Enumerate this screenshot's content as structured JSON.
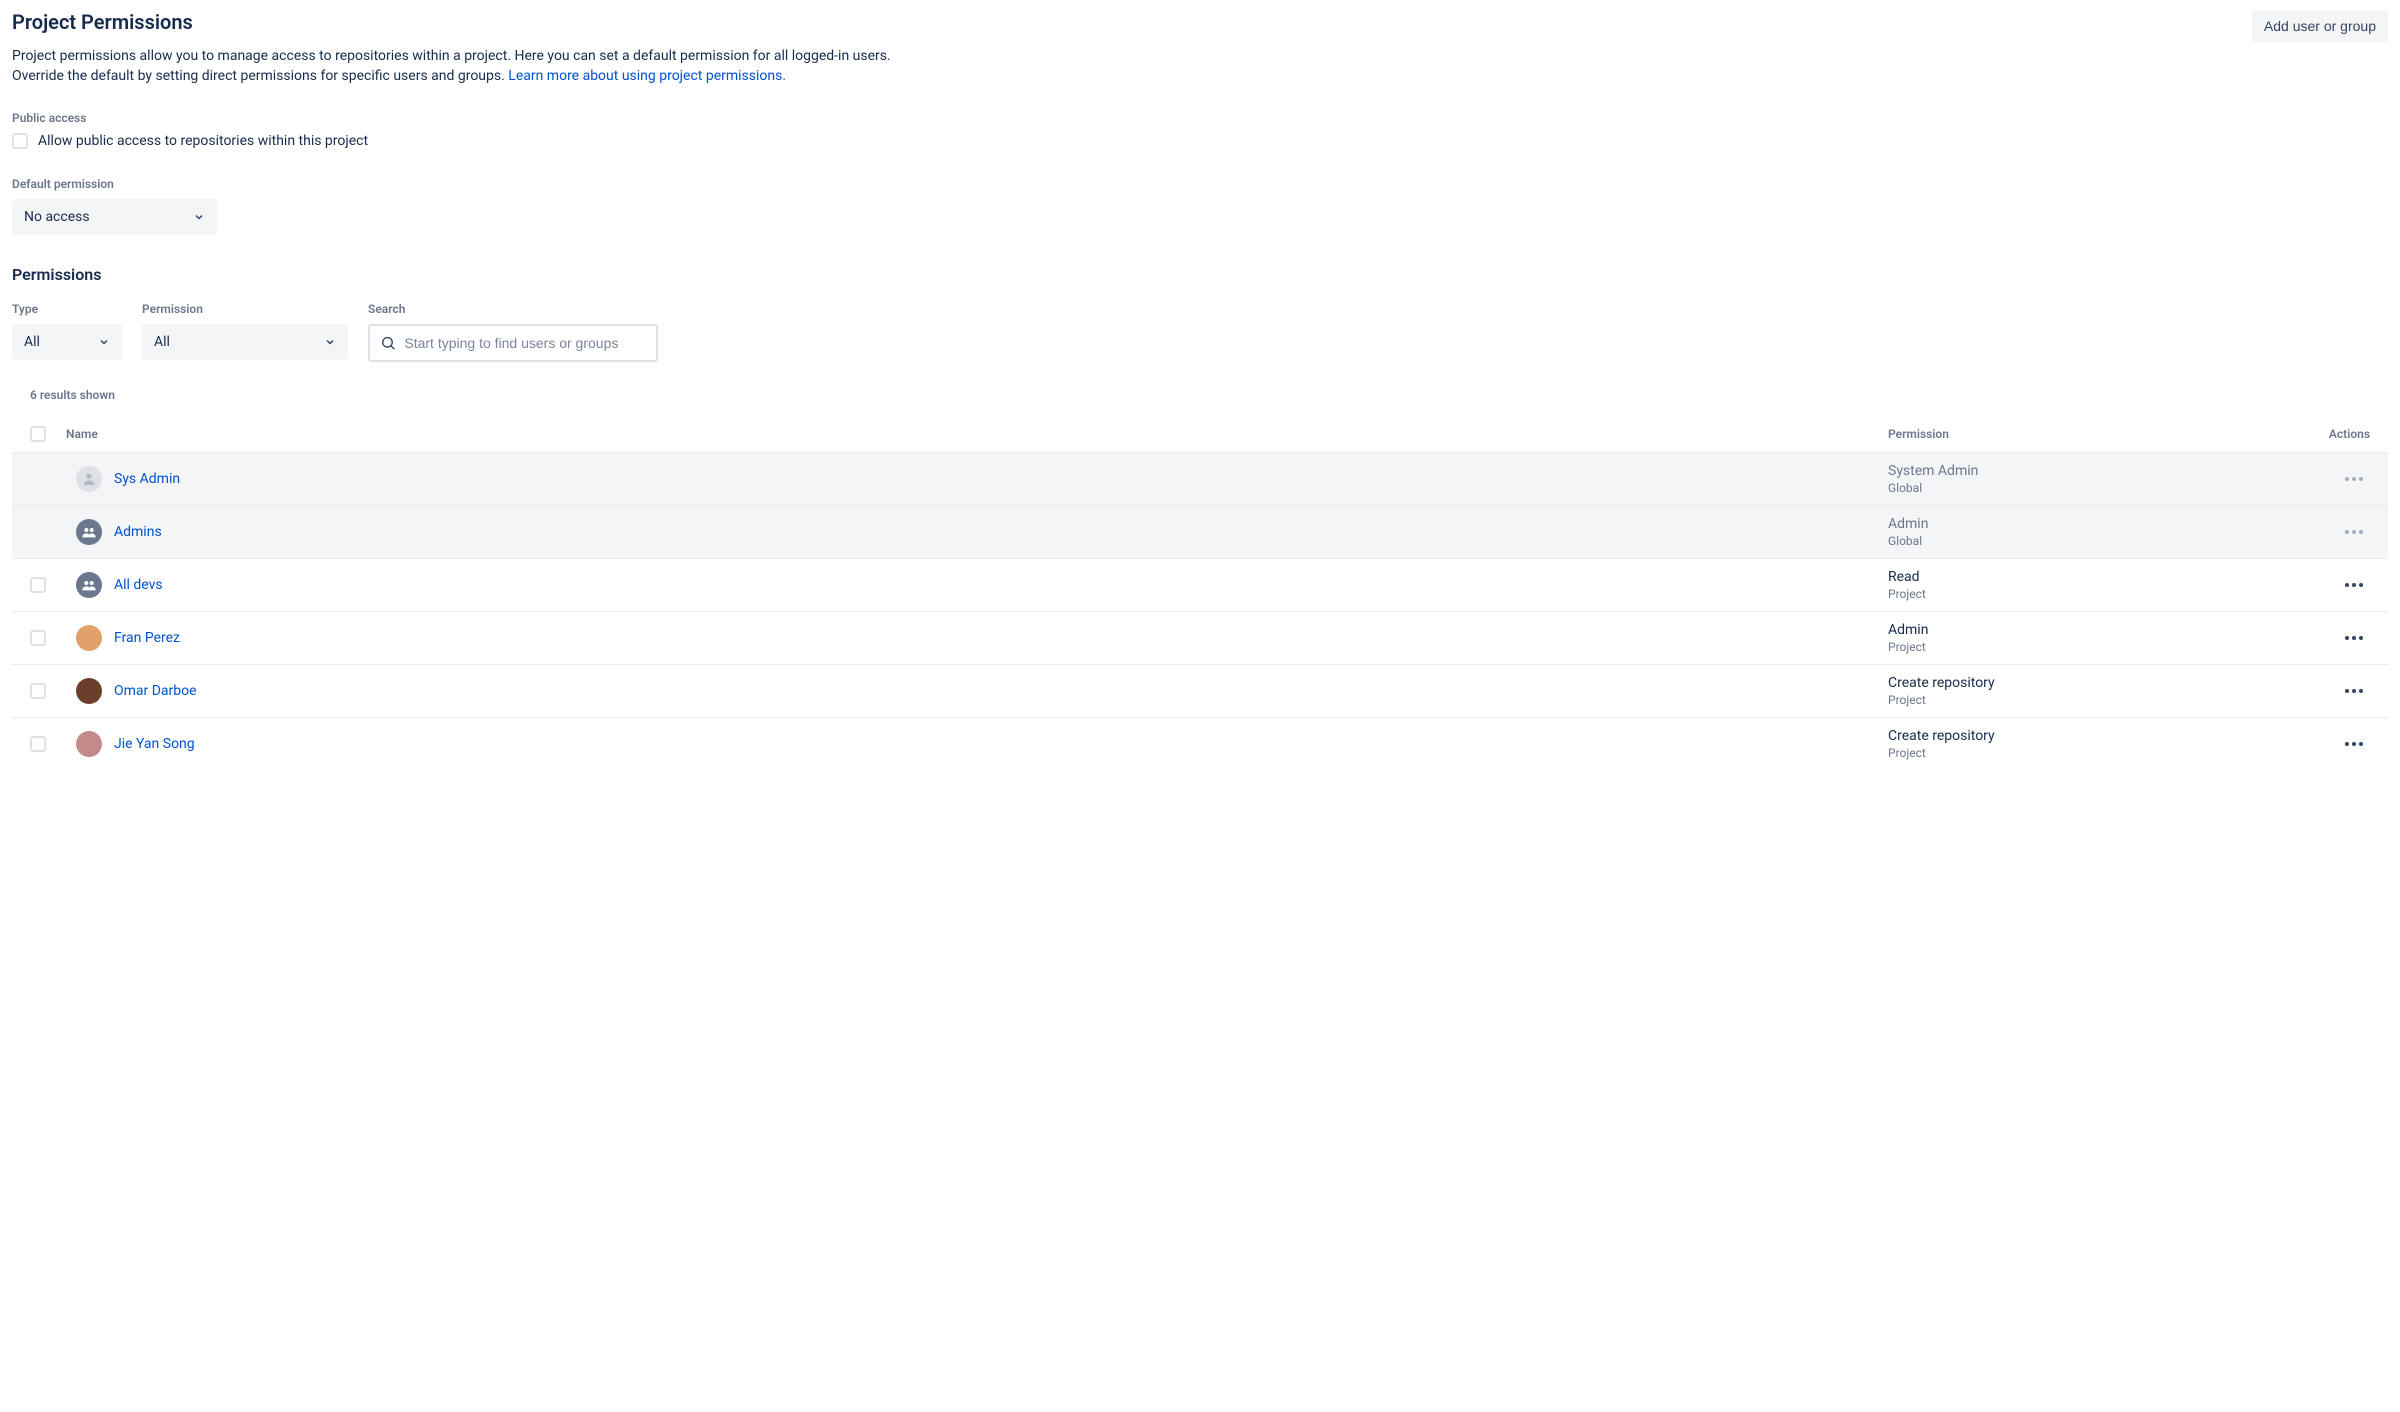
{
  "header": {
    "title": "Project Permissions",
    "add_button": "Add user or group",
    "description_pre": "Project permissions allow you to manage access to repositories within a project. Here you can set a default permission for all logged-in users. Override the default by setting direct permissions for specific users and groups. ",
    "description_link": "Learn more about using project permissions."
  },
  "public_access": {
    "label": "Public access",
    "checkbox_label": "Allow public access to repositories within this project"
  },
  "default_permission": {
    "label": "Default permission",
    "value": "No access"
  },
  "permissions_heading": "Permissions",
  "filters": {
    "type": {
      "label": "Type",
      "value": "All"
    },
    "permission": {
      "label": "Permission",
      "value": "All"
    },
    "search": {
      "label": "Search",
      "placeholder": "Start typing to find users or groups"
    }
  },
  "results_count": "6 results shown",
  "columns": {
    "name": "Name",
    "permission": "Permission",
    "actions": "Actions"
  },
  "rows": [
    {
      "name": "Sys Admin",
      "avatar_type": "user-placeholder",
      "avatar_color": "",
      "permission": "System Admin",
      "scope": "Global",
      "global": true,
      "selectable": false
    },
    {
      "name": "Admins",
      "avatar_type": "group",
      "avatar_color": "",
      "permission": "Admin",
      "scope": "Global",
      "global": true,
      "selectable": false
    },
    {
      "name": "All devs",
      "avatar_type": "group",
      "avatar_color": "",
      "permission": "Read",
      "scope": "Project",
      "global": false,
      "selectable": true
    },
    {
      "name": "Fran Perez",
      "avatar_type": "photo",
      "avatar_color": "#E2A16B",
      "permission": "Admin",
      "scope": "Project",
      "global": false,
      "selectable": true
    },
    {
      "name": "Omar Darboe",
      "avatar_type": "photo",
      "avatar_color": "#6B3F2B",
      "permission": "Create repository",
      "scope": "Project",
      "global": false,
      "selectable": true
    },
    {
      "name": "Jie Yan Song",
      "avatar_type": "photo",
      "avatar_color": "#C48A8A",
      "permission": "Create repository",
      "scope": "Project",
      "global": false,
      "selectable": true
    }
  ]
}
